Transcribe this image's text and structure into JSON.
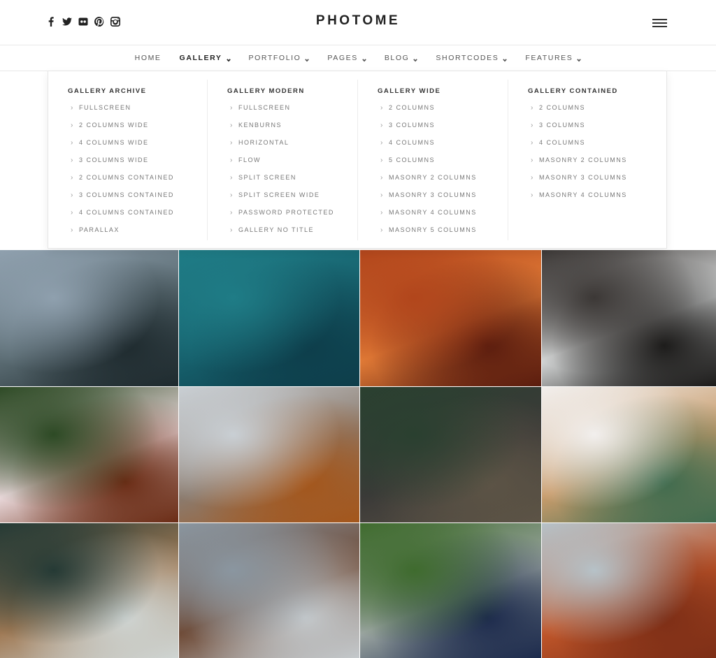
{
  "brand": {
    "logo": "PHOTOME"
  },
  "social": [
    {
      "icon": "facebook-icon"
    },
    {
      "icon": "twitter-icon"
    },
    {
      "icon": "flickr-icon"
    },
    {
      "icon": "pinterest-icon"
    },
    {
      "icon": "instagram-icon"
    }
  ],
  "nav": {
    "items": [
      {
        "label": "HOME",
        "has_dropdown": false
      },
      {
        "label": "GALLERY",
        "has_dropdown": true,
        "active": true
      },
      {
        "label": "PORTFOLIO",
        "has_dropdown": true
      },
      {
        "label": "PAGES",
        "has_dropdown": true
      },
      {
        "label": "BLOG",
        "has_dropdown": true
      },
      {
        "label": "SHORTCODES",
        "has_dropdown": true
      },
      {
        "label": "FEATURES",
        "has_dropdown": true
      }
    ]
  },
  "mega_menu": {
    "columns": [
      {
        "heading": "GALLERY ARCHIVE",
        "items": [
          "FULLSCREEN",
          "2 COLUMNS WIDE",
          "4 COLUMNS WIDE",
          "3 COLUMNS WIDE",
          "2 COLUMNS CONTAINED",
          "3 COLUMNS CONTAINED",
          "4 COLUMNS CONTAINED",
          "PARALLAX"
        ]
      },
      {
        "heading": "GALLERY MODERN",
        "items": [
          "FULLSCREEN",
          "KENBURNS",
          "HORIZONTAL",
          "FLOW",
          "SPLIT SCREEN",
          "SPLIT SCREEN WIDE",
          "PASSWORD PROTECTED",
          "GALLERY NO TITLE"
        ]
      },
      {
        "heading": "GALLERY WIDE",
        "items": [
          "2 COLUMNS",
          "3 COLUMNS",
          "4 COLUMNS",
          "5 COLUMNS",
          "MASONRY 2 COLUMNS",
          "MASONRY 3 COLUMNS",
          "MASONRY 4 COLUMNS",
          "MASONRY 5 COLUMNS"
        ]
      },
      {
        "heading": "GALLERY CONTAINED",
        "items": [
          "2 COLUMNS",
          "3 COLUMNS",
          "4 COLUMNS",
          "MASONRY 2 COLUMNS",
          "MASONRY 3 COLUMNS",
          "MASONRY 4 COLUMNS"
        ]
      }
    ]
  },
  "gallery": {
    "photos": [
      {
        "subject": "mountain-lake-canoe-photo",
        "colors": [
          "#8fa0ae",
          "#5a6b72",
          "#1e2a2e"
        ]
      },
      {
        "subject": "ocean-surfer-photo",
        "colors": [
          "#1f7c86",
          "#16606c",
          "#0d3d4a"
        ]
      },
      {
        "subject": "slot-canyon-photo",
        "colors": [
          "#b2461c",
          "#e07a36",
          "#5a1c0e"
        ]
      },
      {
        "subject": "ocean-waves-aerial-photo",
        "colors": [
          "#3c3836",
          "#d6d8d8",
          "#1b1a19"
        ]
      },
      {
        "subject": "woman-lying-grass-photo",
        "colors": [
          "#2d4a25",
          "#e9d8da",
          "#6a2b14"
        ]
      },
      {
        "subject": "snowy-mountains-autumn-photo",
        "colors": [
          "#c9cfd4",
          "#8b7b6e",
          "#a4561b"
        ]
      },
      {
        "subject": "woman-hat-bench-photo",
        "colors": [
          "#2a4030",
          "#3b3a38",
          "#5d5446"
        ]
      },
      {
        "subject": "woman-holding-pine-bouquet-photo",
        "colors": [
          "#f2efed",
          "#c89c6c",
          "#3f6b4e"
        ]
      },
      {
        "subject": "forest-log-pile-photo",
        "colors": [
          "#253a35",
          "#a07a55",
          "#cfd5d3"
        ]
      },
      {
        "subject": "winter-forest-horse-photo",
        "colors": [
          "#8a96a0",
          "#6e4a36",
          "#c4c9cc"
        ]
      },
      {
        "subject": "woman-park-path-photo",
        "colors": [
          "#3f6b2e",
          "#9ba5a1",
          "#1c2a4c"
        ]
      },
      {
        "subject": "red-rocks-hiker-photo",
        "colors": [
          "#b6c2c8",
          "#c0562a",
          "#7d2e16"
        ]
      }
    ]
  }
}
